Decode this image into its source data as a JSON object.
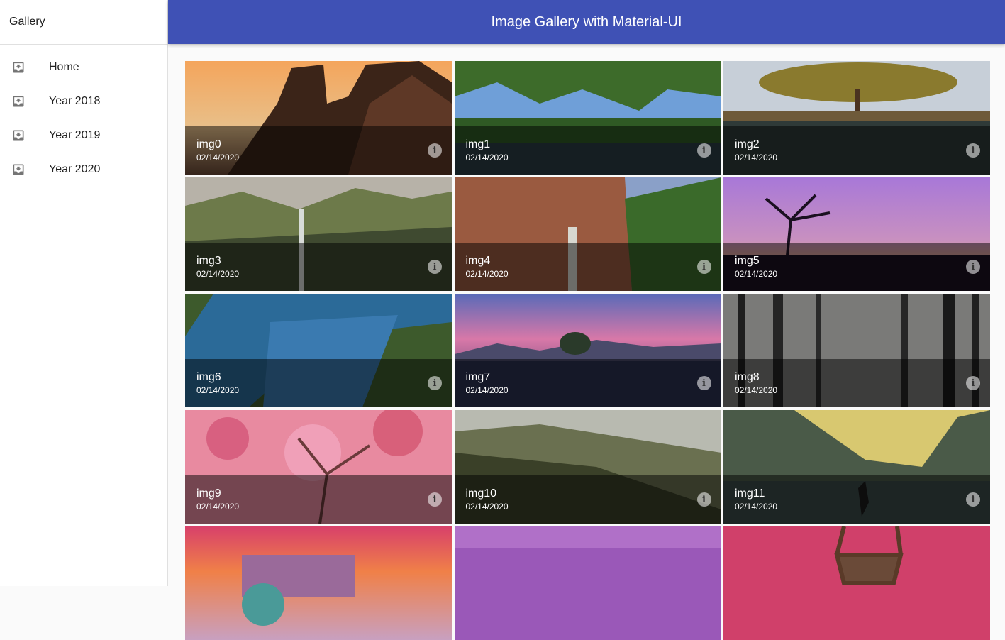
{
  "drawer": {
    "title": "Gallery",
    "items": [
      {
        "label": "Home",
        "icon": "move-to-inbox-icon"
      },
      {
        "label": "Year 2018",
        "icon": "move-to-inbox-icon"
      },
      {
        "label": "Year 2019",
        "icon": "move-to-inbox-icon"
      },
      {
        "label": "Year 2020",
        "icon": "move-to-inbox-icon"
      }
    ]
  },
  "appbar": {
    "title": "Image Gallery with Material-UI",
    "color": "#3f51b5"
  },
  "tiles": [
    {
      "title": "img0",
      "date": "02/14/2020"
    },
    {
      "title": "img1",
      "date": "02/14/2020"
    },
    {
      "title": "img2",
      "date": "02/14/2020"
    },
    {
      "title": "img3",
      "date": "02/14/2020"
    },
    {
      "title": "img4",
      "date": "02/14/2020"
    },
    {
      "title": "img5",
      "date": "02/14/2020"
    },
    {
      "title": "img6",
      "date": "02/14/2020"
    },
    {
      "title": "img7",
      "date": "02/14/2020"
    },
    {
      "title": "img8",
      "date": "02/14/2020"
    },
    {
      "title": "img9",
      "date": "02/14/2020"
    },
    {
      "title": "img10",
      "date": "02/14/2020"
    },
    {
      "title": "img11",
      "date": "02/14/2020"
    },
    {
      "title": "",
      "date": ""
    },
    {
      "title": "",
      "date": ""
    },
    {
      "title": "",
      "date": ""
    }
  ],
  "info_icon": "info-icon"
}
